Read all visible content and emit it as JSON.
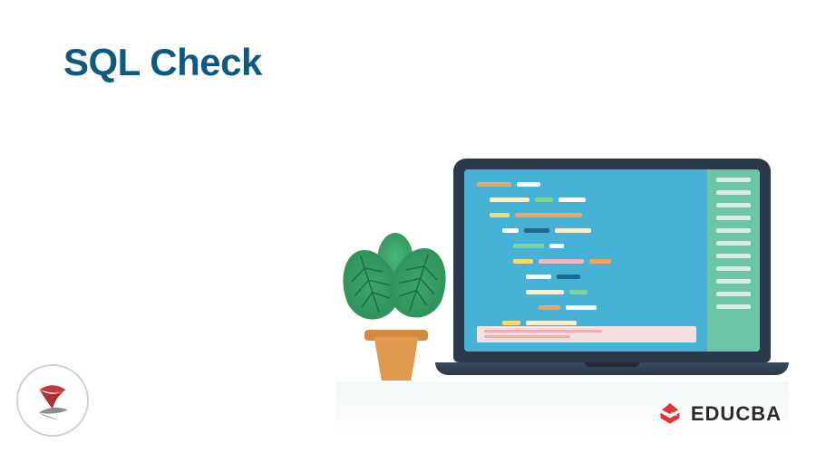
{
  "title": "SQL Check",
  "brand": {
    "name": "EDUCBA",
    "accent_color": "#e33434"
  },
  "corner_logo": {
    "name": "sql-server-icon",
    "colors": {
      "red": "#c43a3a",
      "gray": "#8a8f94"
    }
  },
  "illustration": {
    "laptop": {
      "bezel_color": "#2b3a4a",
      "screen_color": "#46b3d6",
      "sidebar_color": "#6bc5a8",
      "code_colors": {
        "white": "#ffffff",
        "orange": "#f4a259",
        "yellow": "#f7d96a",
        "green": "#7ed59a",
        "cream": "#f7efcf",
        "pink": "#f2b6c0",
        "darkteal": "#1e6a86"
      }
    },
    "plant": {
      "leaf_color": "#2e8b57",
      "pot_color": "#e09a4f"
    }
  }
}
